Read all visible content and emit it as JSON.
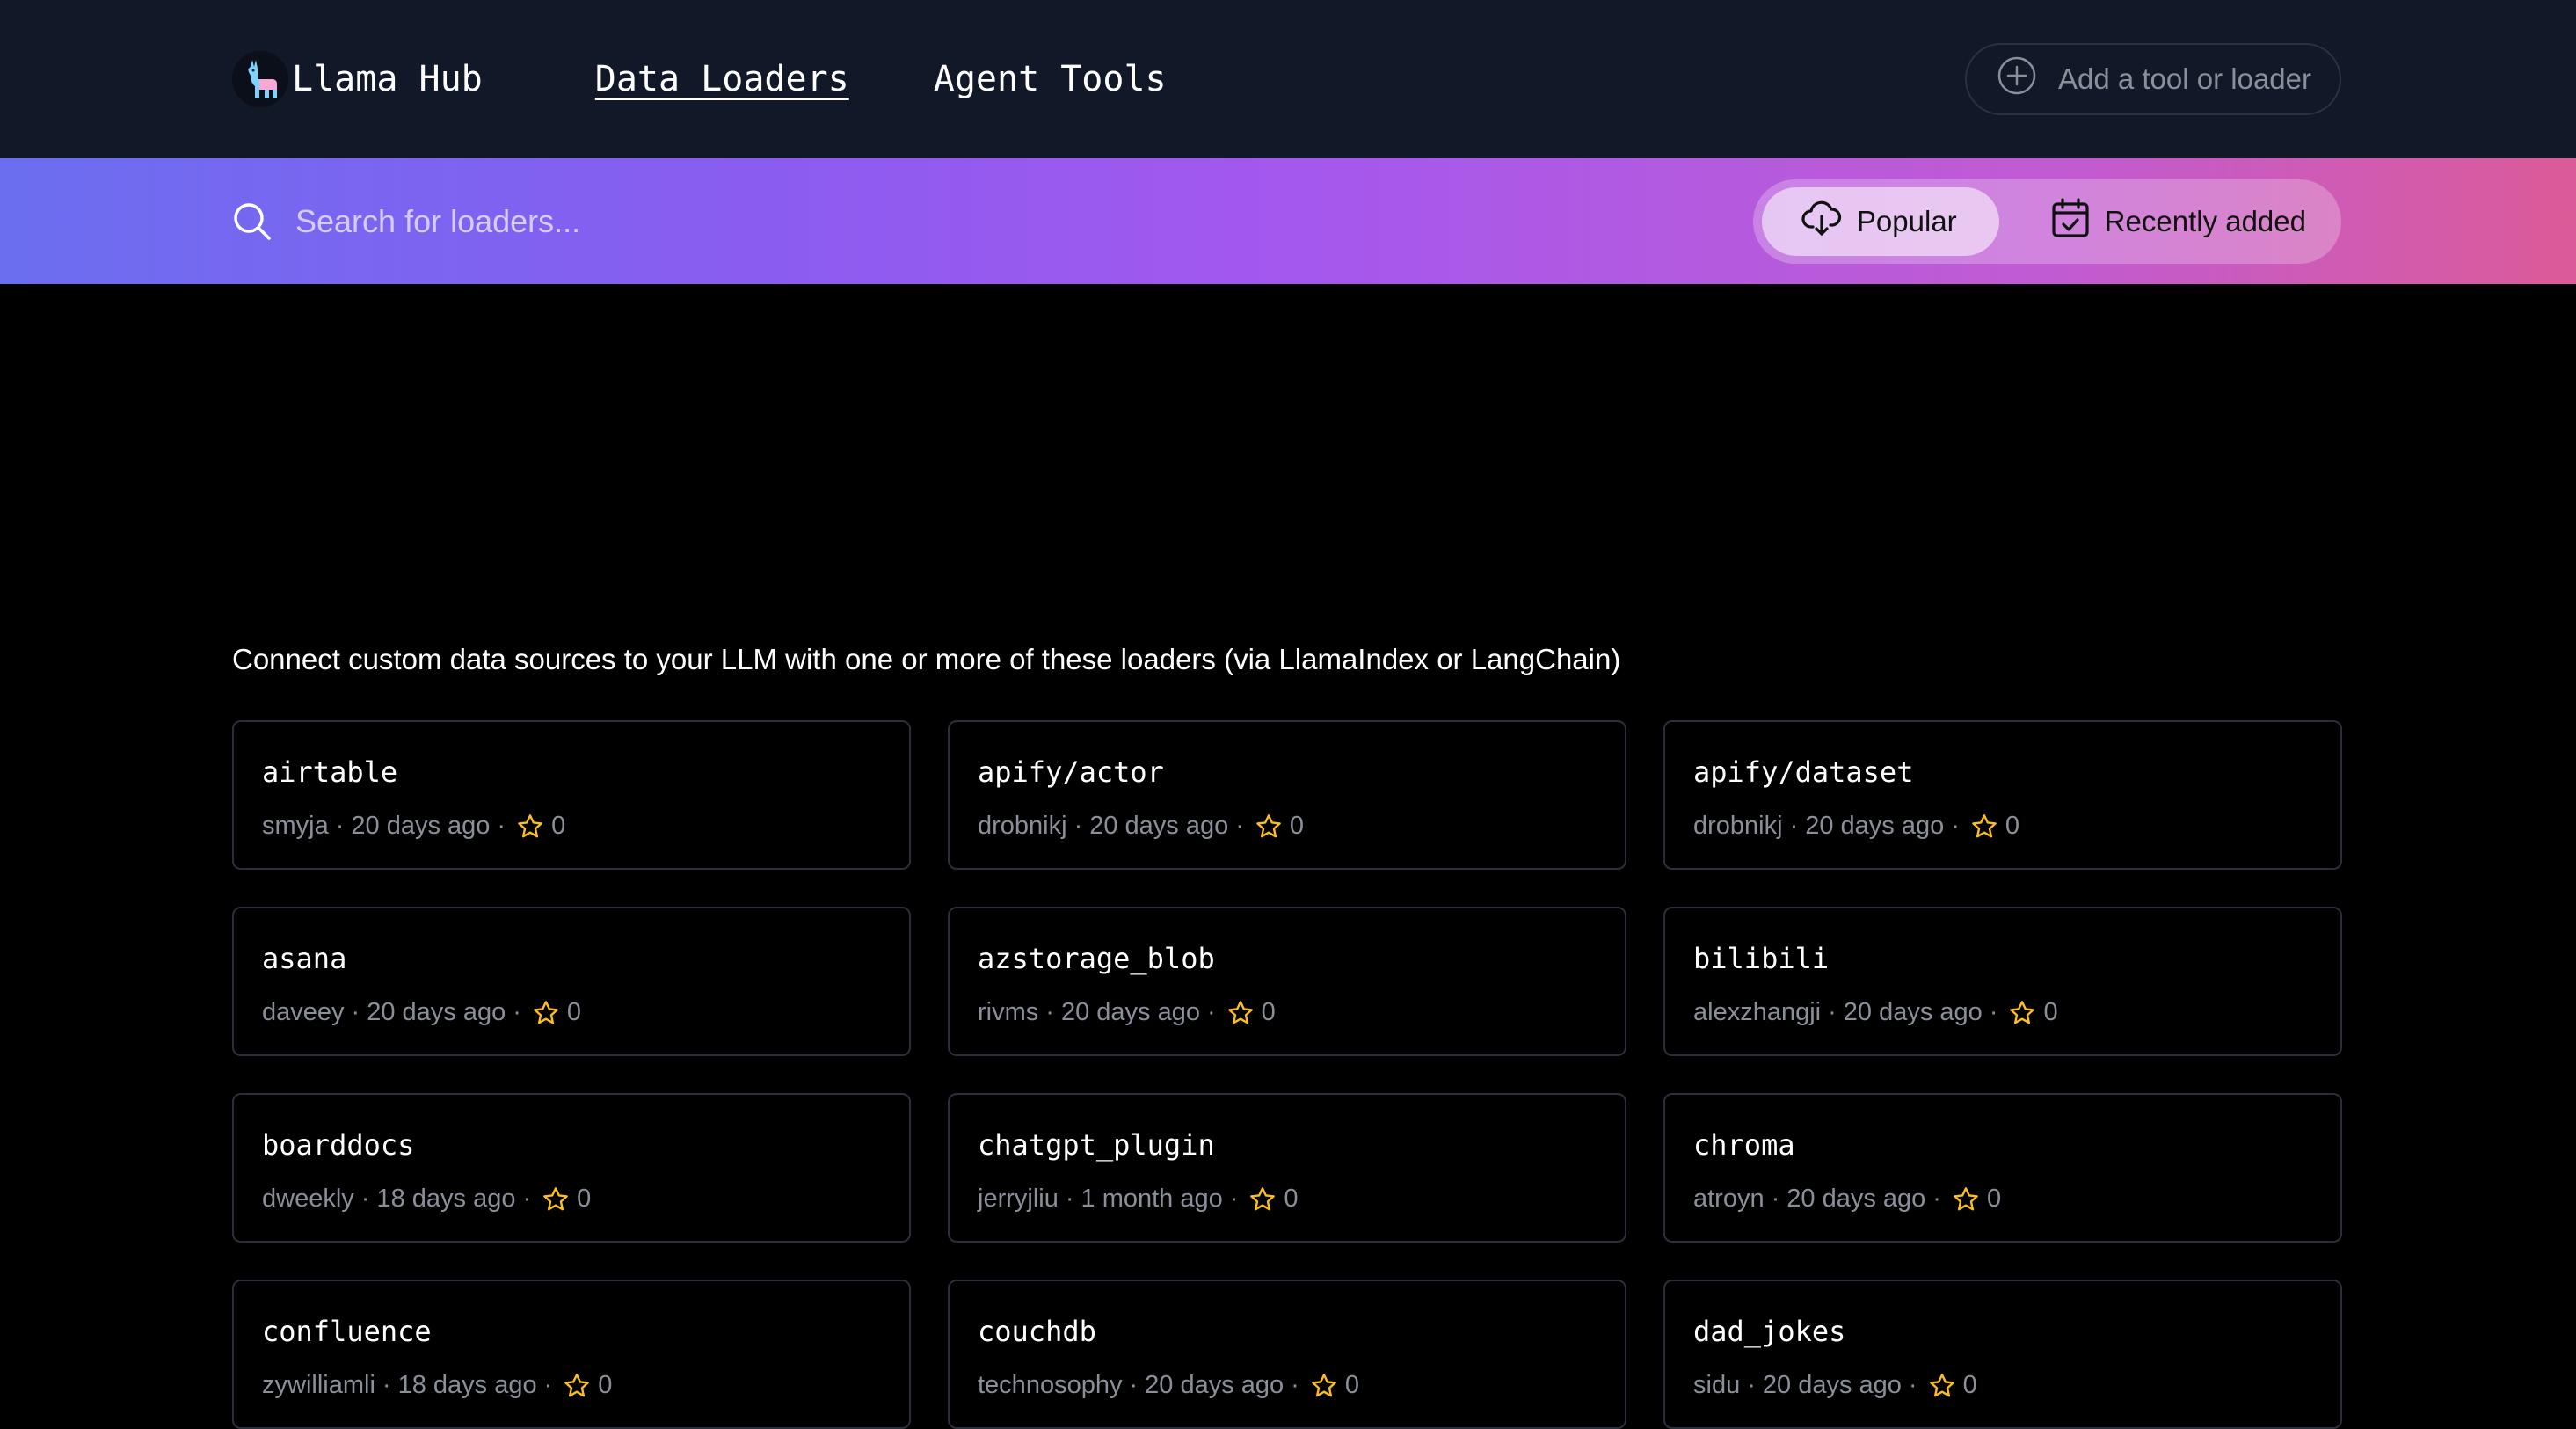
{
  "header": {
    "logo_text": "Llama Hub",
    "nav": [
      {
        "label": "Data Loaders",
        "active": true
      },
      {
        "label": "Agent Tools",
        "active": false
      }
    ],
    "add_button_label": "Add a tool or loader"
  },
  "search": {
    "placeholder": "Search for loaders...",
    "sort_options": [
      {
        "label": "Popular",
        "active": true,
        "icon": "cloud-download-icon"
      },
      {
        "label": "Recently added",
        "active": false,
        "icon": "calendar-check-icon"
      }
    ]
  },
  "intro_text": "Connect custom data sources to your LLM with one or more of these loaders (via LlamaIndex or LangChain)",
  "colors": {
    "accent_star": "#fbbf24",
    "gradient_start": "#6b6ef0",
    "gradient_end": "#db5b98"
  },
  "loaders": [
    {
      "name": "airtable",
      "author": "smyja",
      "updated": "20 days ago",
      "stars": "0"
    },
    {
      "name": "apify/actor",
      "author": "drobnikj",
      "updated": "20 days ago",
      "stars": "0"
    },
    {
      "name": "apify/dataset",
      "author": "drobnikj",
      "updated": "20 days ago",
      "stars": "0"
    },
    {
      "name": "asana",
      "author": "daveey",
      "updated": "20 days ago",
      "stars": "0"
    },
    {
      "name": "azstorage_blob",
      "author": "rivms",
      "updated": "20 days ago",
      "stars": "0"
    },
    {
      "name": "bilibili",
      "author": "alexzhangji",
      "updated": "20 days ago",
      "stars": "0"
    },
    {
      "name": "boarddocs",
      "author": "dweekly",
      "updated": "18 days ago",
      "stars": "0"
    },
    {
      "name": "chatgpt_plugin",
      "author": "jerryjliu",
      "updated": "1 month ago",
      "stars": "0"
    },
    {
      "name": "chroma",
      "author": "atroyn",
      "updated": "20 days ago",
      "stars": "0"
    },
    {
      "name": "confluence",
      "author": "zywilliamli",
      "updated": "18 days ago",
      "stars": "0"
    },
    {
      "name": "couchdb",
      "author": "technosophy",
      "updated": "20 days ago",
      "stars": "0"
    },
    {
      "name": "dad_jokes",
      "author": "sidu",
      "updated": "20 days ago",
      "stars": "0"
    }
  ],
  "separator": "·"
}
